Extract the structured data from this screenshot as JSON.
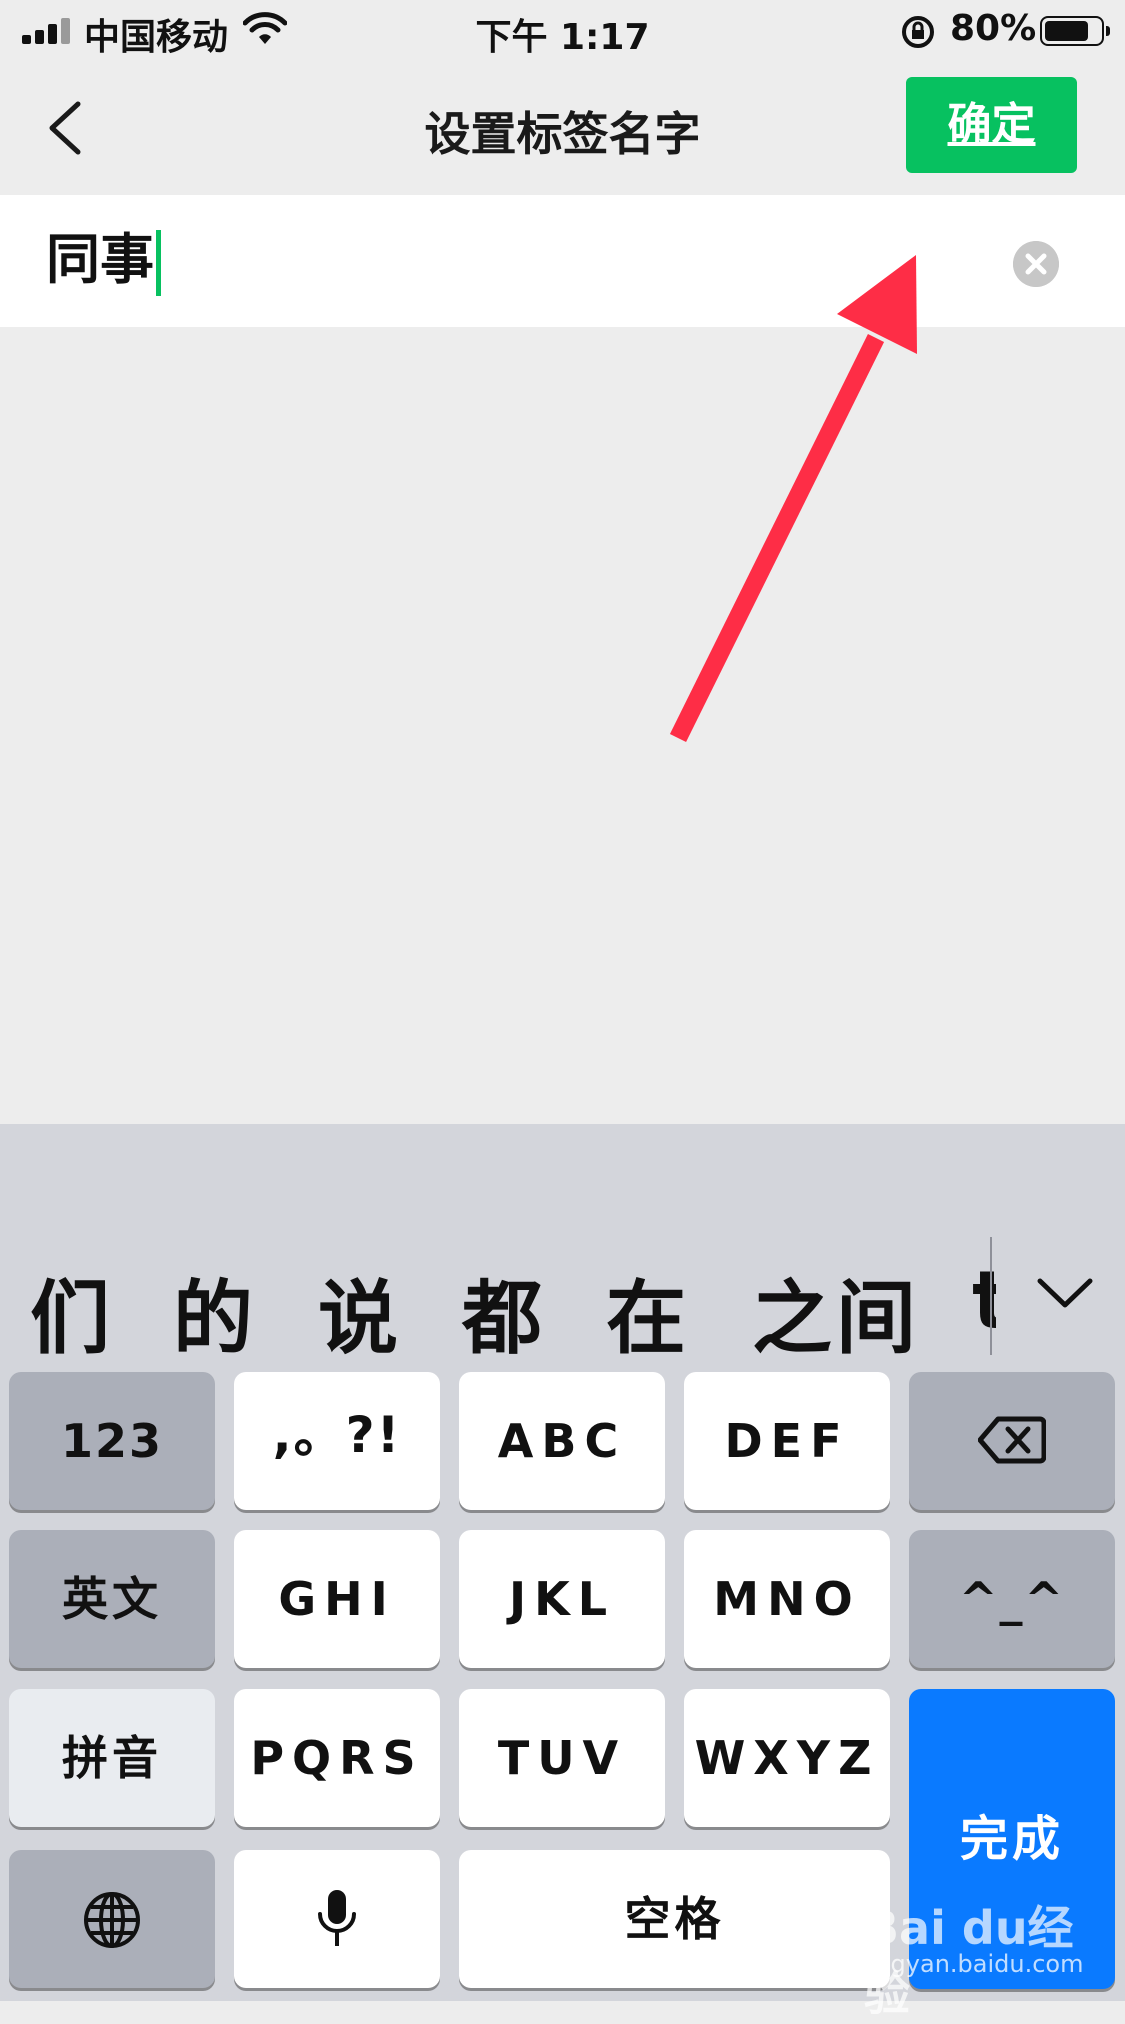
{
  "status_bar": {
    "carrier": "中国移动",
    "time": "下午 1:17",
    "battery_percent": "80%",
    "battery_level": 0.8,
    "icons": [
      "signal-icon",
      "wifi-icon",
      "orientation-lock-icon",
      "battery-icon"
    ]
  },
  "nav": {
    "title": "设置标签名字",
    "confirm_label": "确定",
    "back_icon": "chevron-left-icon"
  },
  "tag_input": {
    "value": "同事",
    "clear_icon": "clear-icon"
  },
  "keyboard": {
    "candidates": [
      "们",
      "的",
      "说",
      "都",
      "在",
      "之间",
      "t"
    ],
    "expand_icon": "chevron-down-icon",
    "keys": {
      "numbers": "123",
      "punctuation": ",。?!",
      "abc": "ABC",
      "def": "DEF",
      "delete_icon": "backspace-icon",
      "english": "英文",
      "ghi": "GHI",
      "jkl": "JKL",
      "mno": "MNO",
      "emoticon": "^_^",
      "pinyin": "拼音",
      "pqrs": "PQRS",
      "tuv": "TUV",
      "wxyz": "WXYZ",
      "globe_icon": "globe-icon",
      "mic_icon": "microphone-icon",
      "space": "空格",
      "done": "完成"
    }
  },
  "watermark": {
    "text": "Bai du经验",
    "url": "jingyan.baidu.com"
  },
  "colors": {
    "accent_green": "#07c160",
    "keyboard_blue": "#0a7aff",
    "annotation_red": "#fe2d46"
  }
}
